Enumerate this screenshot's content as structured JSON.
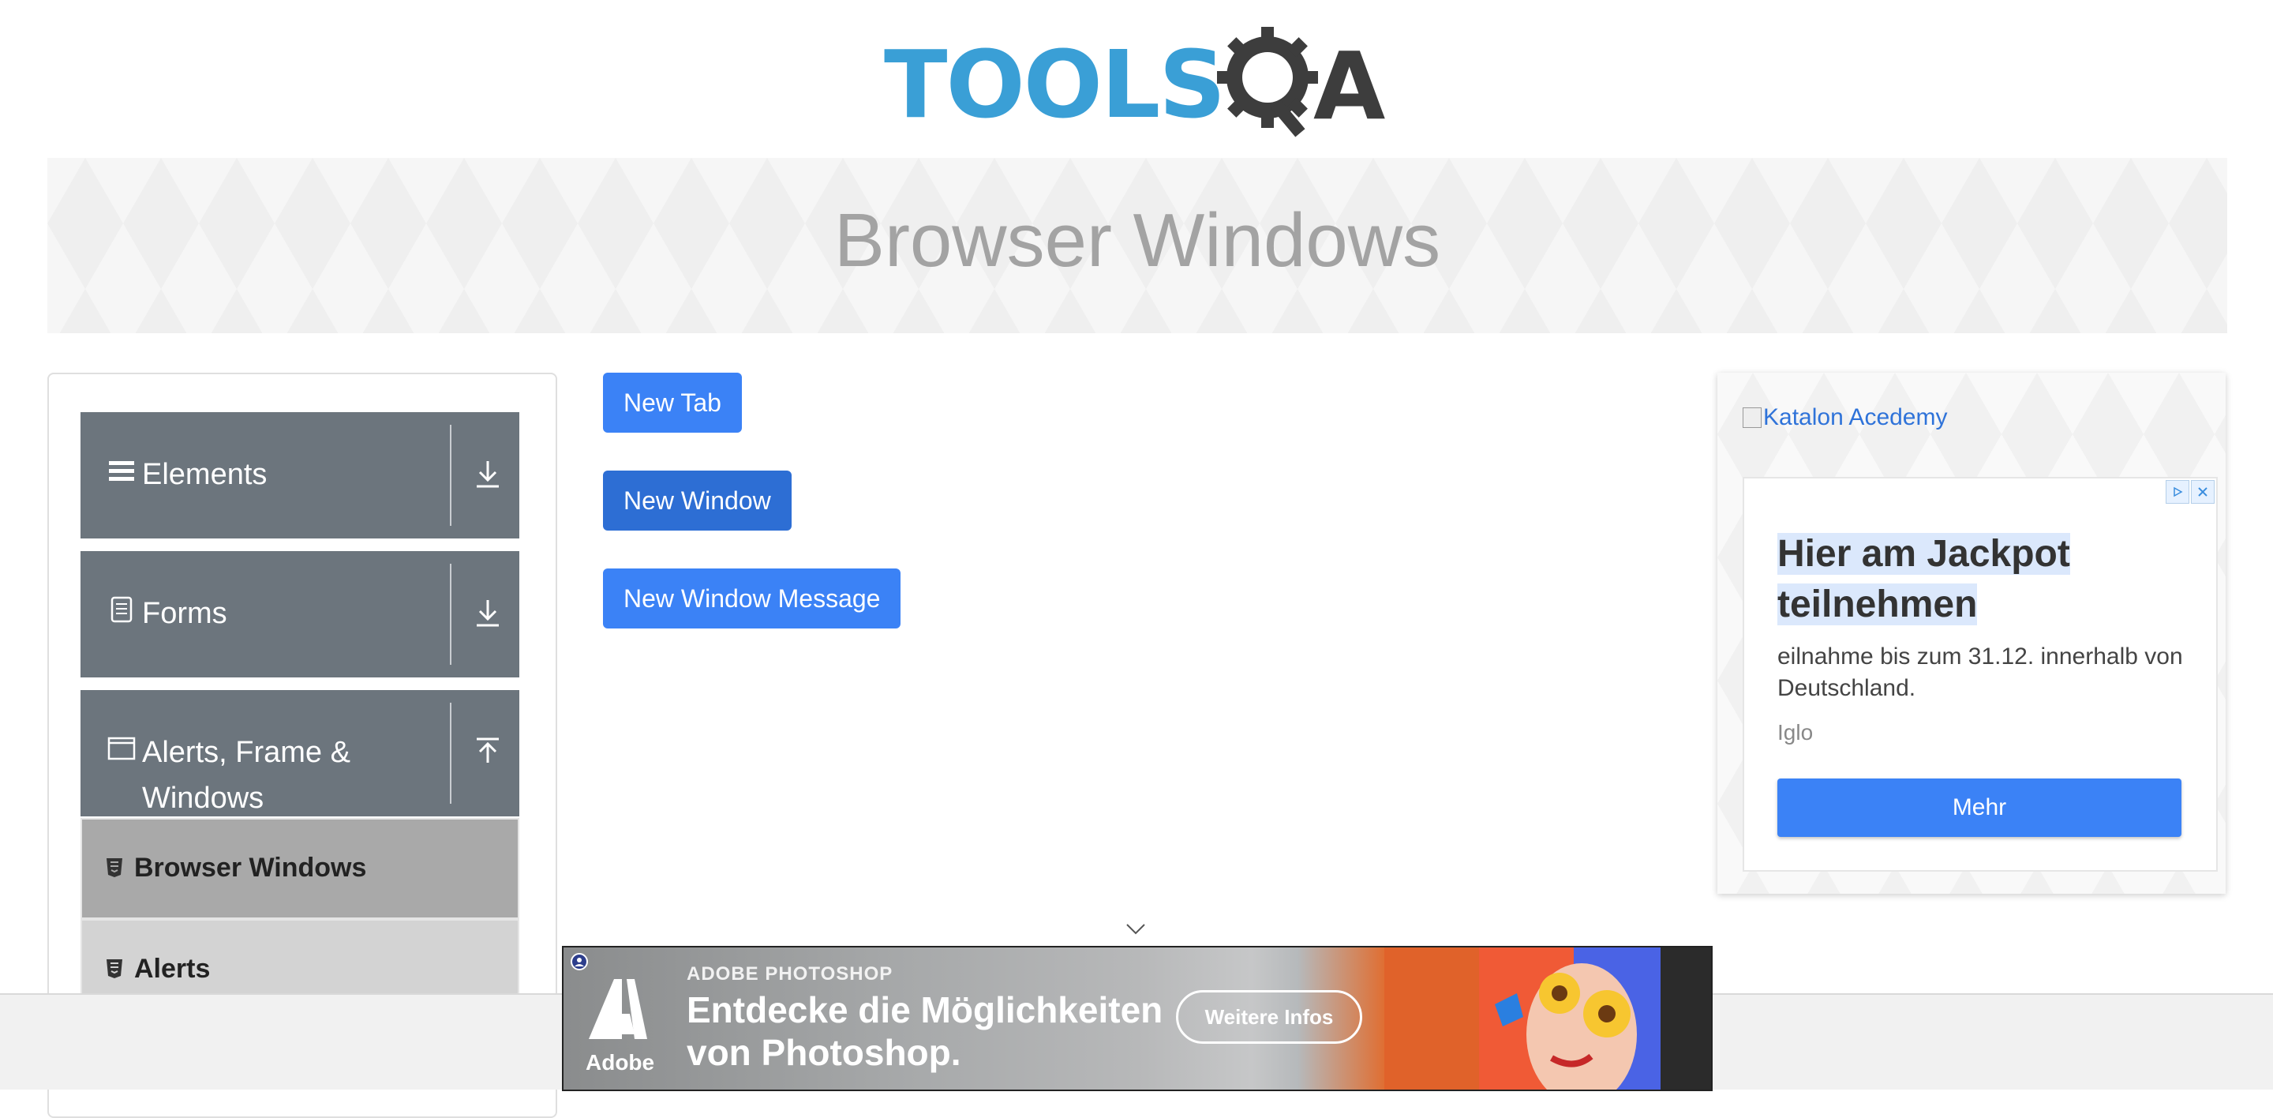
{
  "brand": {
    "logo_text_left": "TOOLS",
    "logo_text_right": "A"
  },
  "page": {
    "title": "Browser Windows"
  },
  "sidebar": {
    "groups": [
      {
        "label": "Elements",
        "icon": "hamburger-icon",
        "expanded": false
      },
      {
        "label": "Forms",
        "icon": "document-icon",
        "expanded": false
      },
      {
        "label": "Alerts, Frame &\nWindows",
        "icon": "window-icon",
        "expanded": true
      }
    ],
    "items": [
      {
        "label": "Browser Windows",
        "active": true,
        "icon": "html5-icon"
      },
      {
        "label": "Alerts",
        "active": false,
        "icon": "html5-icon"
      }
    ]
  },
  "buttons": {
    "new_tab": "New Tab",
    "new_window": "New Window",
    "new_window_message": "New Window Message"
  },
  "ad_right": {
    "image_alt": "Katalon Acedemy",
    "headline_line1": "Hier am Jackpot",
    "headline_line2": "teilnehmen",
    "body": "eilnahme bis zum 31.12. innerhalb von Deutschland.",
    "advertiser": "Iglo",
    "cta": "Mehr"
  },
  "ad_bottom": {
    "brand": "Adobe",
    "eyebrow": "ADOBE PHOTOSHOP",
    "headline": "Entdecke die Möglichkeiten von Photoshop.",
    "cta": "Weitere Infos"
  },
  "colors": {
    "primary_button": "#3b82f6",
    "sidebar_group": "#6c757d",
    "logo_blue": "#3a9fd6",
    "logo_dark": "#3d3d3d"
  }
}
